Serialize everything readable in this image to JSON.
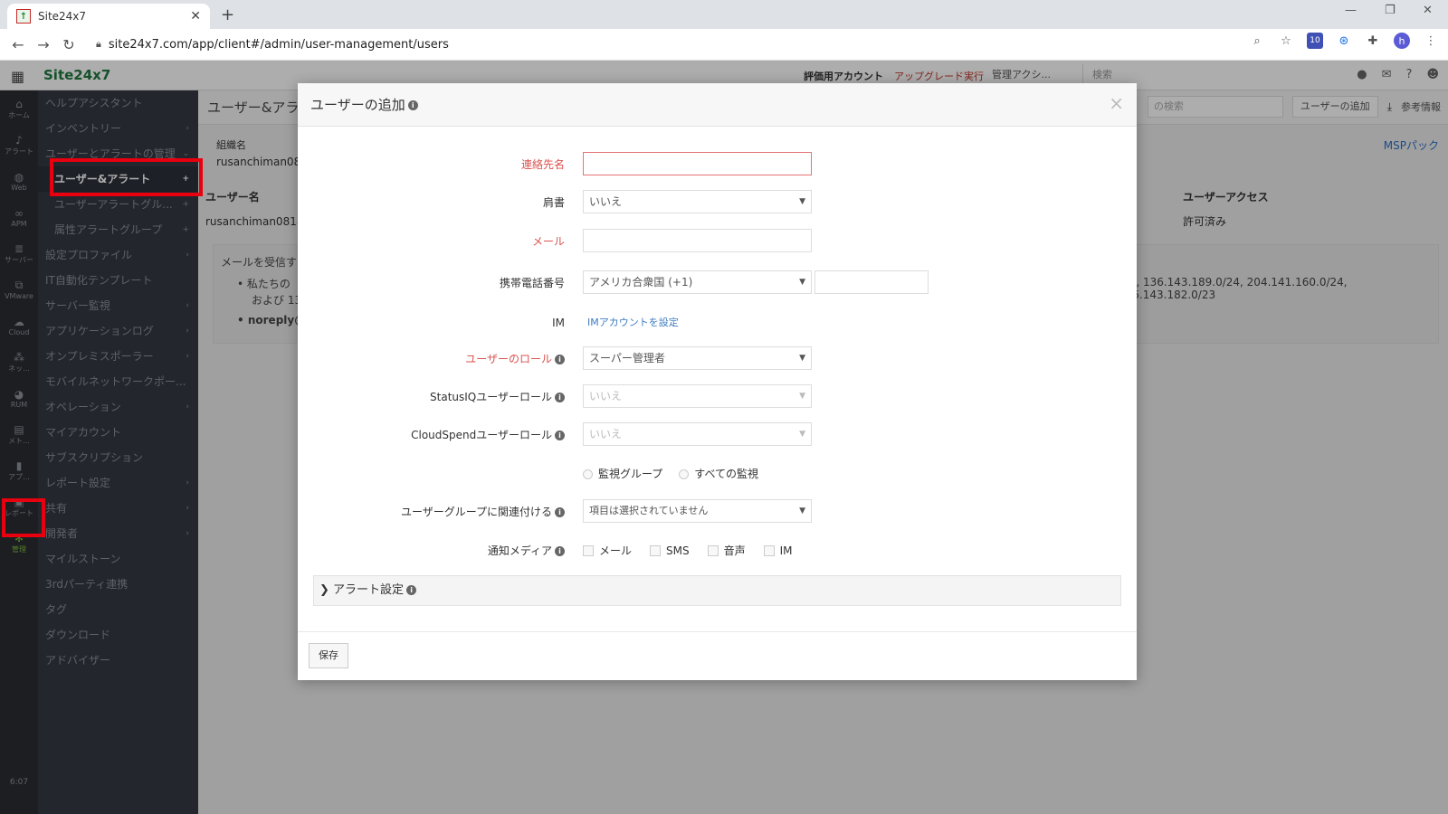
{
  "browser": {
    "tab_title": "Site24x7",
    "url": "site24x7.com/app/client#/admin/user-management/users",
    "ext_badge": "10",
    "profile_initial": "h"
  },
  "app": {
    "brand": "Site24x7",
    "trial_label": "評価用アカウント",
    "upgrade_label": "アップグレード実行",
    "admin_action_label": "管理アクシ...",
    "search_placeholder": "検索"
  },
  "rail": {
    "items": [
      "ホーム",
      "アラート",
      "Web",
      "APM",
      "サーバー",
      "VMware",
      "Cloud",
      "ネッ...",
      "RUM",
      "メト...",
      "アプ...",
      "レポート",
      "管理"
    ],
    "time": "6:07"
  },
  "sidenav": {
    "items": [
      {
        "label": "ヘルプアシスタント",
        "chev": ""
      },
      {
        "label": "インベントリー",
        "chev": "›"
      },
      {
        "label": "ユーザーとアラートの管理",
        "chev": "⌄"
      },
      {
        "label": "ユーザー&アラート",
        "chev": "+"
      },
      {
        "label": "ユーザーアラートグル...",
        "chev": "+"
      },
      {
        "label": "属性アラートグループ",
        "chev": "+"
      },
      {
        "label": "設定プロファイル",
        "chev": "›"
      },
      {
        "label": "IT自動化テンプレート",
        "chev": ""
      },
      {
        "label": "サーバー監視",
        "chev": "›"
      },
      {
        "label": "アプリケーションログ",
        "chev": "›"
      },
      {
        "label": "オンプレミスポーラー",
        "chev": "›"
      },
      {
        "label": "モバイルネットワークポー...",
        "chev": ""
      },
      {
        "label": "オペレーション",
        "chev": "›"
      },
      {
        "label": "マイアカウント",
        "chev": ""
      },
      {
        "label": "サブスクリプション",
        "chev": ""
      },
      {
        "label": "レポート設定",
        "chev": "›"
      },
      {
        "label": "共有",
        "chev": "›"
      },
      {
        "label": "開発者",
        "chev": "›"
      },
      {
        "label": "マイルストーン",
        "chev": ""
      },
      {
        "label": "3rdパーティ連携",
        "chev": ""
      },
      {
        "label": "タグ",
        "chev": ""
      },
      {
        "label": "ダウンロード",
        "chev": ""
      },
      {
        "label": "アドバイザー",
        "chev": ""
      }
    ]
  },
  "main": {
    "page_title": "ユーザー&アラ",
    "search_placeholder": "の検索",
    "add_user_label": "ユーザーの追加",
    "reference_label": "参考情報",
    "org_label": "組織名",
    "org_value": "rusanchiman081",
    "col_username": "ユーザー名",
    "col_access": "ユーザーアクセス",
    "row_username": "rusanchiman0818 (",
    "row_access": "許可済み",
    "msp_label": "MSPパック",
    "info_line1": "メールを受信す",
    "info_line2": "• 私たちの",
    "info_line3": "および 13",
    "info_line4": "• noreply@",
    "info_ips": "/24, 136.143.189.0/24, 204.141.160.0/24, 136.143.182.0/23"
  },
  "modal": {
    "title": "ユーザーの追加",
    "fields": {
      "contact_name": {
        "label": "連絡先名",
        "value": ""
      },
      "title": {
        "label": "肩書",
        "value": "いいえ"
      },
      "email": {
        "label": "メール",
        "value": ""
      },
      "phone": {
        "label": "携帯電話番号",
        "country": "アメリカ合衆国 (+1)",
        "number": ""
      },
      "im": {
        "label": "IM",
        "link": "IMアカウントを設定"
      },
      "user_role": {
        "label": "ユーザーのロール",
        "value": "スーパー管理者"
      },
      "statusiq_role": {
        "label": "StatusIQユーザーロール",
        "value": "いいえ"
      },
      "cloudspend_role": {
        "label": "CloudSpendユーザーロール",
        "value": "いいえ"
      },
      "monitor_scope": {
        "option1": "監視グループ",
        "option2": "すべての監視"
      },
      "user_group": {
        "label": "ユーザーグループに関連付ける",
        "value": "項目は選択されていません"
      },
      "notify_media": {
        "label": "通知メディア",
        "options": [
          "メール",
          "SMS",
          "音声",
          "IM"
        ]
      }
    },
    "alert_settings_label": "アラート設定",
    "save_label": "保存"
  }
}
